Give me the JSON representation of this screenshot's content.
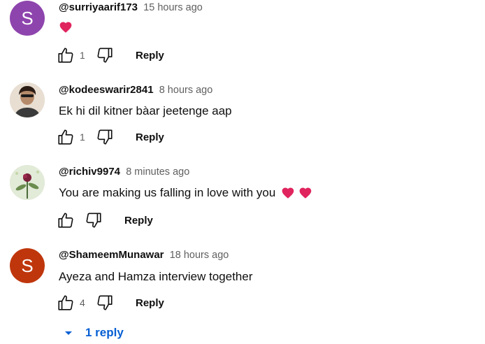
{
  "colors": {
    "author": "#0f0f0f",
    "timestamp": "#606060",
    "text": "#0f0f0f",
    "link_blue": "#065fd4",
    "heart_red": "#e0245e"
  },
  "action_labels": {
    "reply": "Reply"
  },
  "comments": [
    {
      "author": "@surriyaarif173",
      "time": "15 hours ago",
      "text": "",
      "emoji": [
        "red-heart",
        ""
      ],
      "likes": "1",
      "avatar": {
        "letter": "S",
        "color": "#8e44ad",
        "type": "letter"
      }
    },
    {
      "author": "@kodeeswarir2841",
      "time": "8 hours ago",
      "text": "Ek hi dil kitner bàar jeetenge aap",
      "likes": "1",
      "avatar": {
        "type": "photo",
        "icon": "person-photo-avatar"
      }
    },
    {
      "author": "@richiv9974",
      "time": "8 minutes ago",
      "text": "You are making us falling in love with you",
      "emoji": [
        "red-heart",
        "red-heart"
      ],
      "likes": "",
      "avatar": {
        "type": "photo",
        "icon": "flower-photo-avatar"
      }
    },
    {
      "author": "@ShameemMunawar",
      "time": "18 hours ago",
      "text": "Ayeza and Hamza interview together",
      "likes": "4",
      "avatar": {
        "letter": "S",
        "color": "#bf360c",
        "type": "letter"
      }
    }
  ],
  "replies_toggle": {
    "label": "1 reply"
  }
}
